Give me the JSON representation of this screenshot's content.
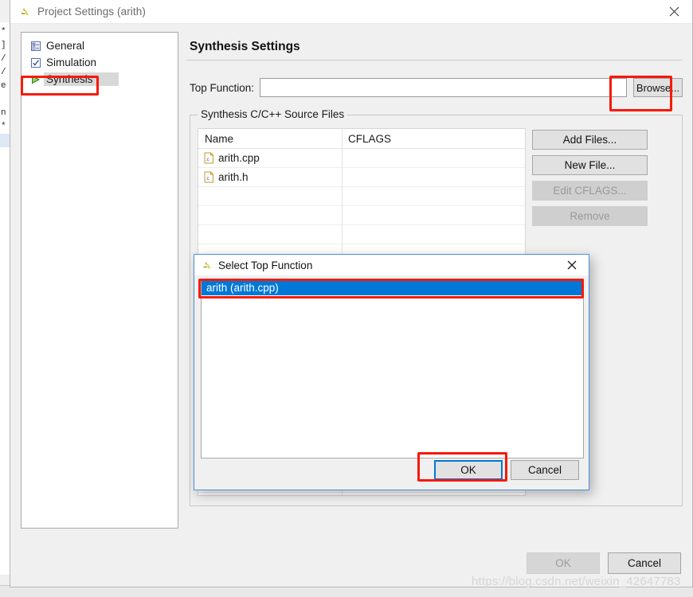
{
  "window": {
    "title": "Project Settings (arith)",
    "icon": "vivado-hls-icon",
    "close_icon": "close-icon"
  },
  "sidebar": {
    "items": [
      {
        "label": "General",
        "icon": "form-icon",
        "selected": false
      },
      {
        "label": "Simulation",
        "icon": "checkbox-icon",
        "selected": false
      },
      {
        "label": "Synthesis",
        "icon": "green-play-icon",
        "selected": true
      }
    ]
  },
  "pane": {
    "heading": "Synthesis Settings",
    "top_function": {
      "label": "Top Function:",
      "value": "",
      "placeholder": "",
      "browse_label": "Browse..."
    },
    "source_files": {
      "legend": "Synthesis C/C++ Source Files",
      "columns": [
        "Name",
        "CFLAGS"
      ],
      "rows": [
        {
          "name": "arith.cpp",
          "cflags": "",
          "icon": "c-file-icon"
        },
        {
          "name": "arith.h",
          "cflags": "",
          "icon": "c-file-icon"
        },
        {
          "name": "",
          "cflags": "",
          "icon": ""
        },
        {
          "name": "",
          "cflags": "",
          "icon": ""
        },
        {
          "name": "",
          "cflags": "",
          "icon": ""
        },
        {
          "name": "",
          "cflags": "",
          "icon": ""
        },
        {
          "name": "",
          "cflags": "",
          "icon": ""
        },
        {
          "name": "",
          "cflags": "",
          "icon": ""
        },
        {
          "name": "",
          "cflags": "",
          "icon": ""
        },
        {
          "name": "",
          "cflags": "",
          "icon": ""
        },
        {
          "name": "",
          "cflags": "",
          "icon": ""
        },
        {
          "name": "",
          "cflags": "",
          "icon": ""
        },
        {
          "name": "",
          "cflags": "",
          "icon": ""
        },
        {
          "name": "",
          "cflags": "",
          "icon": ""
        },
        {
          "name": "",
          "cflags": "",
          "icon": ""
        },
        {
          "name": "",
          "cflags": "",
          "icon": ""
        },
        {
          "name": "",
          "cflags": "",
          "icon": ""
        },
        {
          "name": "",
          "cflags": "",
          "icon": ""
        }
      ],
      "buttons": [
        {
          "label": "Add Files...",
          "enabled": true
        },
        {
          "label": "New File...",
          "enabled": true
        },
        {
          "label": "Edit CFLAGS...",
          "enabled": false
        },
        {
          "label": "Remove",
          "enabled": false
        }
      ]
    }
  },
  "footer": {
    "ok_label": "OK",
    "ok_enabled": false,
    "cancel_label": "Cancel",
    "cancel_enabled": true
  },
  "dialog": {
    "title": "Select Top Function",
    "icon": "vivado-hls-icon",
    "close_icon": "close-icon",
    "options": [
      {
        "label": "arith (arith.cpp)",
        "selected": true
      }
    ],
    "ok_label": "OK",
    "cancel_label": "Cancel"
  },
  "annotations": {
    "color": "#f61a07",
    "targets": [
      "sidebar-item-synthesis",
      "browse-button",
      "selected-option",
      "dialog-ok-button"
    ]
  },
  "watermark": "https://blog.csdn.net/weixin_42647783",
  "background": {
    "editor_fragments": [
      "]",
      "/",
      "/",
      "e",
      "",
      "n",
      "*",
      "",
      ""
    ]
  }
}
